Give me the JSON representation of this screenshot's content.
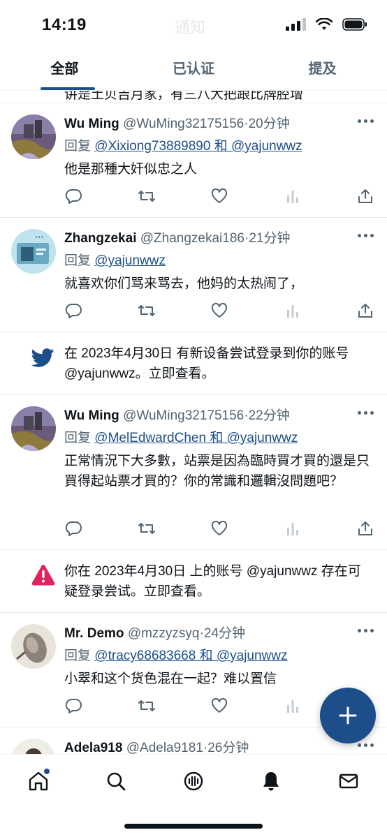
{
  "status_bar": {
    "time": "14:19",
    "faded_title": "通知"
  },
  "tabs": [
    {
      "label": "全部",
      "active": true
    },
    {
      "label": "已认证",
      "active": false
    },
    {
      "label": "提及",
      "active": false
    }
  ],
  "cut_top_text": "讲是土贝吉月家，有三八大把跟比牌腔增",
  "reply_prefix": "回复",
  "feed": {
    "t1": {
      "name": "Wu Ming",
      "handle": "@WuMing32175156",
      "sep": "·",
      "time": "20分钟",
      "reply_to": "@Xixiong73889890 和 @yajunwwz",
      "text": "他是那種大奸似忠之人"
    },
    "t2": {
      "name": "Zhangzekai",
      "handle": "@Zhangzekai186",
      "sep": "·",
      "time": "21分钟",
      "reply_to": "@yajunwwz",
      "text": "就喜欢你们骂来骂去，他妈的太热闹了，"
    },
    "n1": {
      "text": "在 2023年4月30日 有新设备尝试登录到你的账号 @yajunwwz。立即查看。",
      "icon": "twitter-bird-icon"
    },
    "t3": {
      "name": "Wu Ming",
      "handle": "@WuMing32175156",
      "sep": "·",
      "time": "22分钟",
      "reply_to": "@MelEdwardChen 和 @yajunwwz",
      "text": "正常情況下大多數，站票是因為臨時買才買的還是只買得起站票才買的？你的常識和邏輯沒問題吧？"
    },
    "n2": {
      "text": "你在 2023年4月30日 上的账号 @yajunwwz 存在可疑登录尝试。立即查看。",
      "icon": "warning-icon"
    },
    "t4": {
      "name": "Mr. Demo",
      "handle": "@mzzyzsyq",
      "sep": "·",
      "time": "24分钟",
      "reply_to": "@tracy68683668 和 @yajunwwz",
      "text": "小翠和这个货色混在一起？难以置信"
    },
    "t5": {
      "name": "Adela918",
      "handle": "@Adela9181",
      "sep": "·",
      "time": "26分钟"
    }
  },
  "colors": {
    "accent": "#1d4e89",
    "secondary_text": "#536471",
    "warning": "#e0245e",
    "bird": "#1d4e89"
  }
}
